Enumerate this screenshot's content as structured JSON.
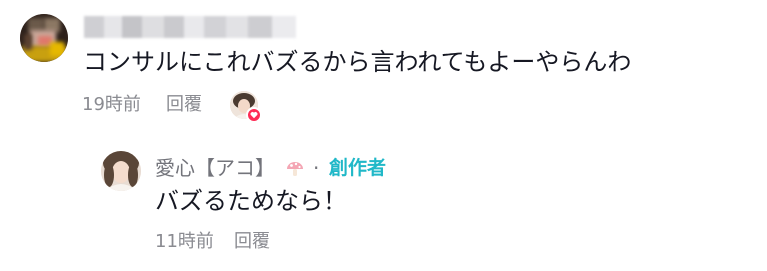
{
  "comment": {
    "username_blurred": true,
    "text": "コンサルにこれバズるから言われてもよーやらんわ",
    "time": "19時前",
    "reply_label": "回覆",
    "liked_by_creator": true
  },
  "reply": {
    "username": "愛心【アコ】",
    "emoji": "mushroom-emoji",
    "separator": "·",
    "badge": "創作者",
    "text": "バズるためなら！",
    "time": "11時前",
    "reply_label": "回覆"
  },
  "colors": {
    "text_primary": "#161823",
    "text_secondary": "#8a8b91",
    "creator_badge": "#20b8c8",
    "like_heart": "#fe2c55"
  }
}
